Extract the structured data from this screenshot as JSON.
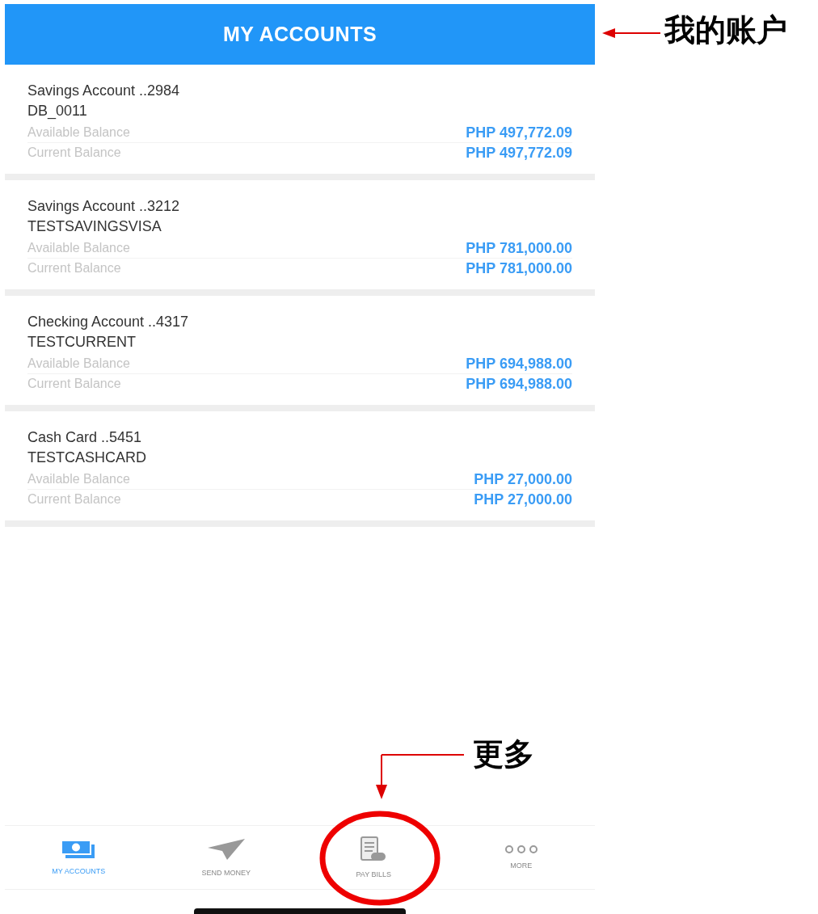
{
  "header": {
    "title": "MY ACCOUNTS"
  },
  "accounts": [
    {
      "name": "Savings Account ..2984",
      "nickname": "DB_0011",
      "rows": [
        {
          "label": "Available Balance",
          "amount": "PHP 497,772.09"
        },
        {
          "label": "Current Balance",
          "amount": "PHP 497,772.09"
        }
      ]
    },
    {
      "name": "Savings Account ..3212",
      "nickname": "TESTSAVINGSVISA",
      "rows": [
        {
          "label": "Available Balance",
          "amount": "PHP 781,000.00"
        },
        {
          "label": "Current Balance",
          "amount": "PHP 781,000.00"
        }
      ]
    },
    {
      "name": "Checking Account ..4317",
      "nickname": "TESTCURRENT",
      "rows": [
        {
          "label": "Available Balance",
          "amount": "PHP 694,988.00"
        },
        {
          "label": "Current Balance",
          "amount": "PHP 694,988.00"
        }
      ]
    },
    {
      "name": "Cash Card ..5451",
      "nickname": "TESTCASHCARD",
      "rows": [
        {
          "label": "Available Balance",
          "amount": "PHP 27,000.00"
        },
        {
          "label": "Current Balance",
          "amount": "PHP 27,000.00"
        }
      ]
    }
  ],
  "tab_bar": {
    "tabs": [
      {
        "label": "MY ACCOUNTS",
        "kind": "cash",
        "selected": true
      },
      {
        "label": "SEND MONEY",
        "kind": "plane",
        "selected": false
      },
      {
        "label": "PAY BILLS",
        "kind": "bill",
        "selected": false
      },
      {
        "label": "MORE",
        "kind": "dots",
        "selected": false
      }
    ]
  },
  "annotations": [
    {
      "text": "我的账户"
    },
    {
      "text": "更多"
    }
  ]
}
